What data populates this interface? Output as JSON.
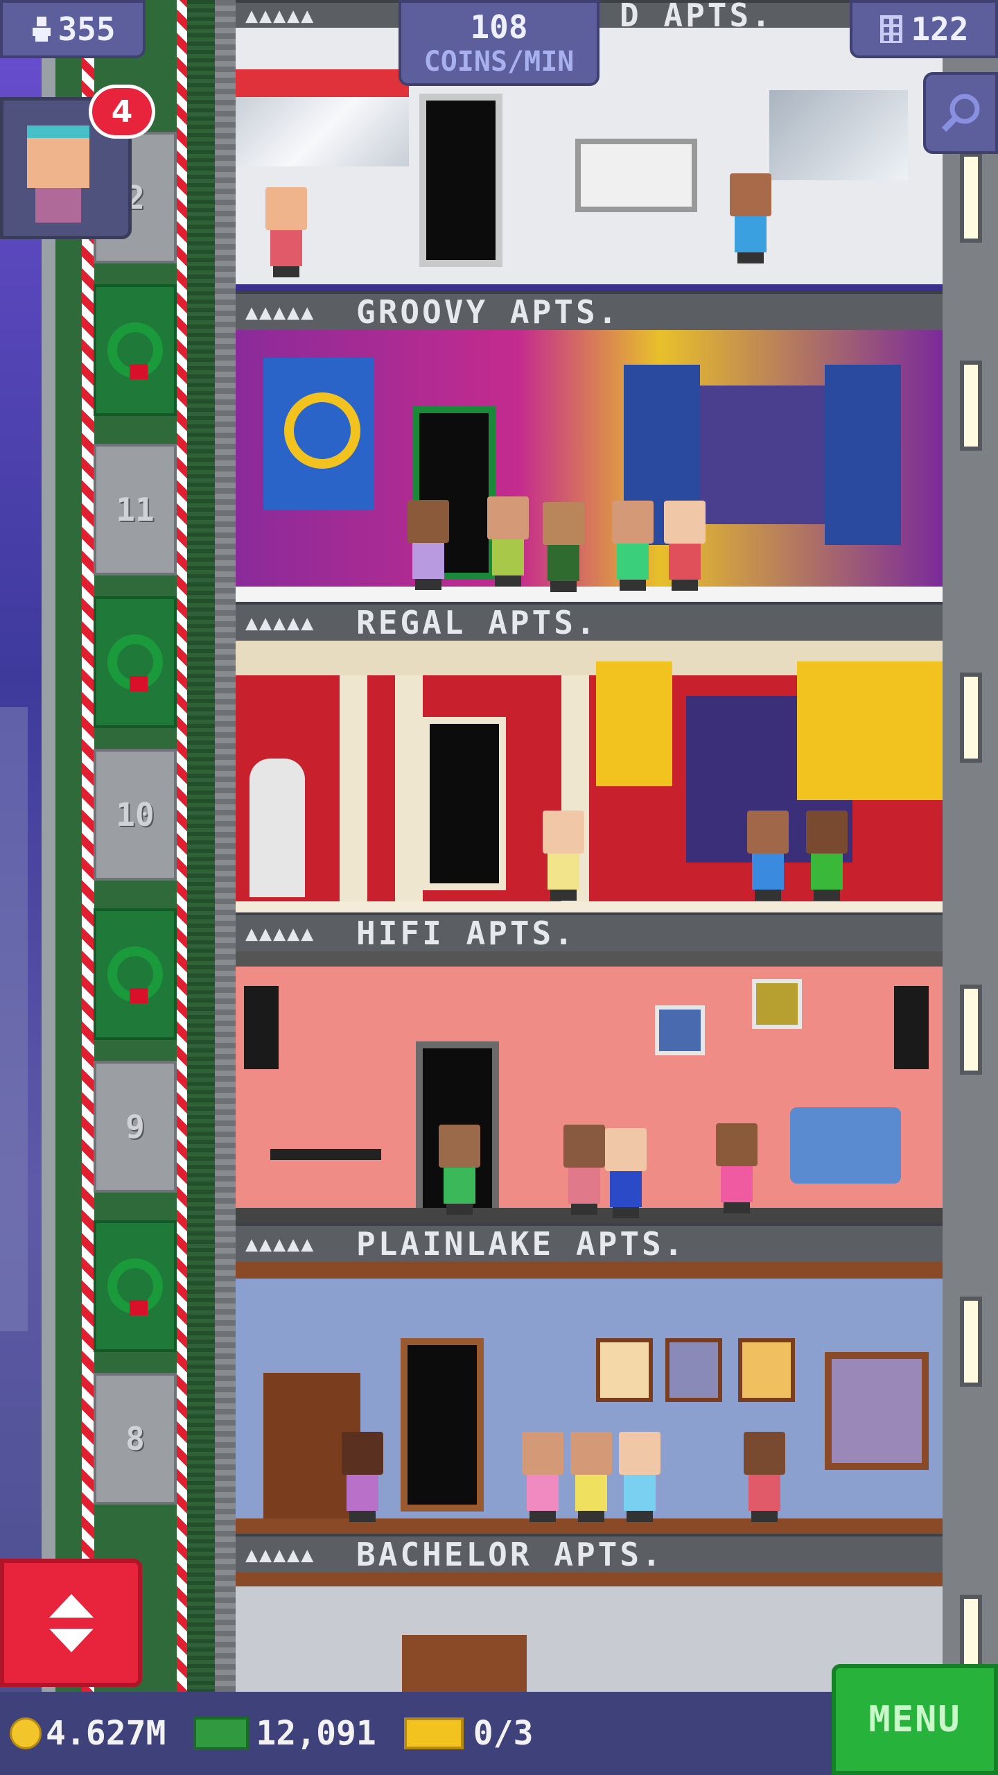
{
  "hud": {
    "population": "355",
    "income_value": "108",
    "income_unit": "COINS/MIN",
    "floors_count": "122",
    "notification_count": "4"
  },
  "top_floor": {
    "name_partial": "D APTS."
  },
  "elevator": {
    "car_numbers": [
      "2",
      "11",
      "10",
      "9",
      "8"
    ]
  },
  "floors": [
    {
      "name": "GROOVY APTS.",
      "pips": "▲▲▲▲▲"
    },
    {
      "name": "REGAL APTS.",
      "pips": "▲▲▲▲▲"
    },
    {
      "name": "HIFI APTS.",
      "pips": "▲▲▲▲▲"
    },
    {
      "name": "PLAINLAKE APTS.",
      "pips": "▲▲▲▲▲"
    },
    {
      "name": "BACHELOR APTS.",
      "pips": "▲▲▲▲▲"
    }
  ],
  "bottom_bar": {
    "coins": "4.627M",
    "bux": "12,091",
    "tickets": "0/3",
    "menu_label": "MENU"
  },
  "icons": {
    "population": "person-icon",
    "floors": "building-icon",
    "search": "magnifier-icon",
    "elevator": "up-down-arrows-icon"
  },
  "colors": {
    "menu_green": "#27b23b",
    "elevator_red": "#e8243c",
    "hud_purple": "#5d5f9c"
  }
}
